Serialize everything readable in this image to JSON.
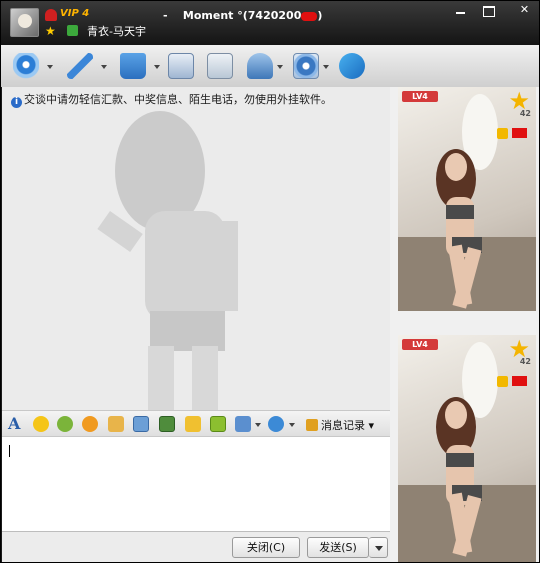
{
  "title": {
    "vip_label": "VIP 4",
    "dash": "-",
    "name_prefix": "Moment °(7420200",
    "close_paren": ")",
    "sub_name": "青衣-马天宇"
  },
  "window_controls": {
    "close": "✕"
  },
  "toolbar_icons": [
    "video-icon",
    "microphone-icon",
    "send-file-icon",
    "sms-icon",
    "add-member-icon",
    "app-icon",
    "settings-icon",
    "qzone-icon"
  ],
  "notice": {
    "icon": "i",
    "text": "交谈中请勿轻信汇款、中奖信息、陌生电话，勿使用外挂软件。"
  },
  "format_bar": {
    "font_glyph": "A",
    "msg_record": "消息记录"
  },
  "buttons": {
    "close": "关闭(C)",
    "send": "发送(S)"
  },
  "profile_cards": [
    {
      "level": "LV4",
      "star_value": "42"
    },
    {
      "level": "LV4",
      "star_value": "42"
    }
  ],
  "colors": {
    "accent": "#2a6bc8",
    "vip": "#ffb400",
    "titlebar": "#1b1b1b"
  }
}
